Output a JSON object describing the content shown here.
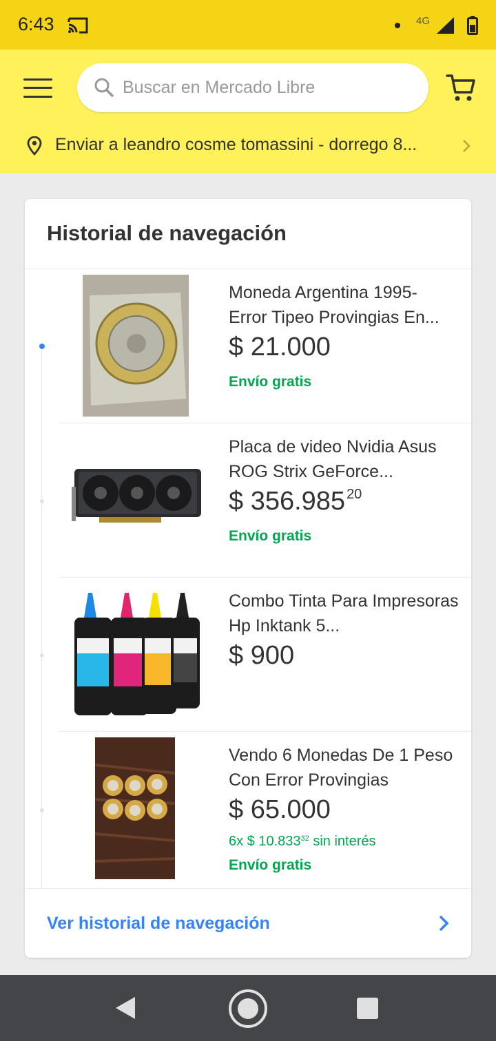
{
  "status_bar": {
    "time": "6:43",
    "network": "4G"
  },
  "header": {
    "search": {
      "placeholder": "Buscar en Mercado Libre",
      "value": ""
    },
    "address": "Enviar a leandro cosme tomassini - dorrego 8..."
  },
  "history": {
    "title": "Historial de navegación",
    "items": [
      {
        "title": "Moneda Argentina 1995- Error Tipeo Provingias En...",
        "price": "$ 21.000",
        "price_cents": "",
        "installments": null,
        "shipping": "Envío gratis"
      },
      {
        "title": "Placa de video Nvidia Asus  ROG Strix GeForce...",
        "price": "$ 356.985",
        "price_cents": "20",
        "installments": null,
        "shipping": "Envío gratis"
      },
      {
        "title": "Combo Tinta Para Impresoras Hp Inktank 5...",
        "price": "$ 900",
        "price_cents": "",
        "installments": null,
        "shipping": null
      },
      {
        "title": "Vendo 6 Monedas De 1 Peso Con Error Provingias",
        "price": "$ 65.000",
        "price_cents": "",
        "installments": {
          "prefix": "6x $ 10.833",
          "cents": "32",
          "suffix": "sin interés"
        },
        "shipping": "Envío gratis"
      }
    ],
    "footer_link": "Ver historial de navegación"
  },
  "colors": {
    "brand_yellow": "#fff159",
    "status_yellow": "#f5d415",
    "link_blue": "#3483fa",
    "free_shipping_green": "#00a650"
  },
  "icons": [
    "cast-icon",
    "signal-icon",
    "battery-icon",
    "menu-icon",
    "search-icon",
    "cart-icon",
    "location-pin-icon",
    "chevron-right-icon",
    "back-icon",
    "home-icon",
    "recents-icon"
  ]
}
